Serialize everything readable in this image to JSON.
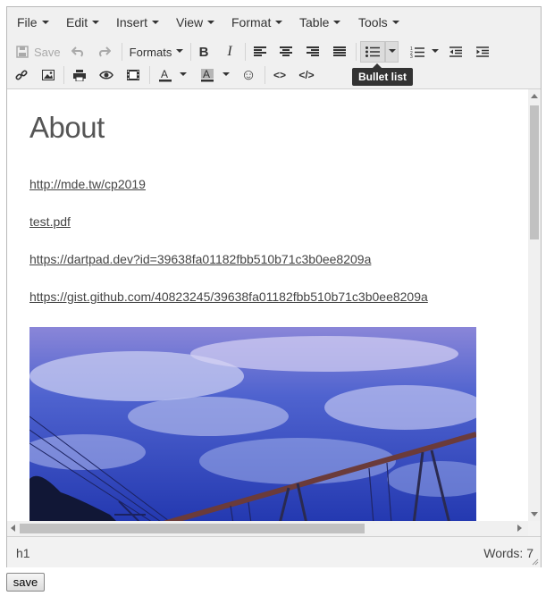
{
  "menubar": {
    "items": [
      {
        "label": "File"
      },
      {
        "label": "Edit"
      },
      {
        "label": "Insert"
      },
      {
        "label": "View"
      },
      {
        "label": "Format"
      },
      {
        "label": "Table"
      },
      {
        "label": "Tools"
      }
    ]
  },
  "toolbar": {
    "save_label": "Save",
    "formats_label": "Formats",
    "bold_label": "B",
    "italic_label": "I",
    "tooltip": "Bullet list",
    "emoji_glyph": "☺",
    "code_glyph": "<>",
    "source_glyph": "</>"
  },
  "content": {
    "heading": "About",
    "links": [
      "http://mde.tw/cp2019",
      "test.pdf",
      "https://dartpad.dev?id=39638fa01182fbb510b71c3b0ee8209a",
      "https://gist.github.com/40823245/39638fa01182fbb510b71c3b0ee8209a"
    ]
  },
  "statusbar": {
    "path": "h1",
    "word_count": "Words: 7"
  },
  "page": {
    "save_button": "save"
  },
  "colors": {
    "sky_top": "#5d72d6",
    "sky_bottom": "#2a3fb8",
    "swing_frame": "#6b3b3a"
  }
}
